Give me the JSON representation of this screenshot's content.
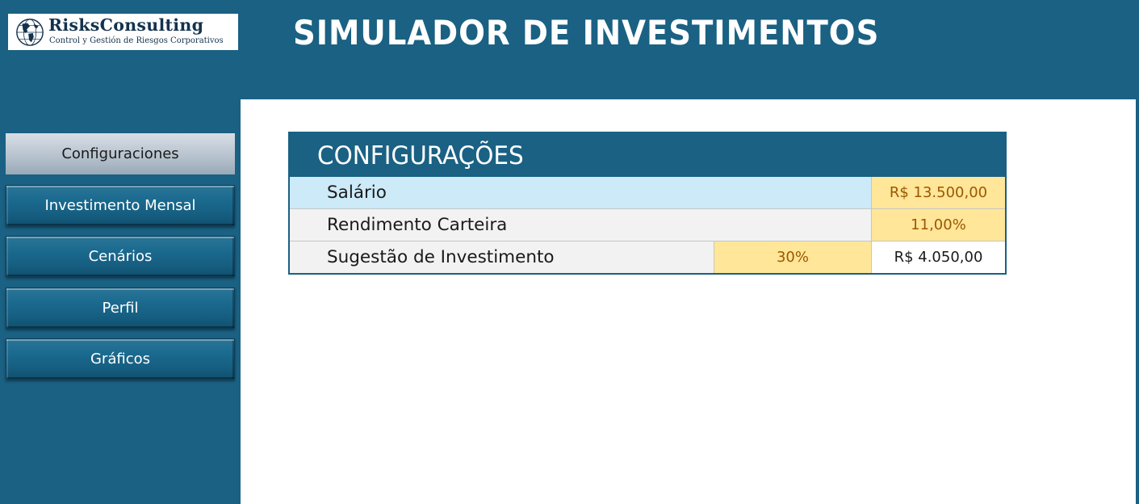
{
  "header": {
    "logo": {
      "name": "RisksConsulting",
      "tagline": "Control y Gestión de Riesgos Corporativos"
    },
    "title": "SIMULADOR DE INVESTIMENTOS",
    "background_color": "#1a6183"
  },
  "sidebar": {
    "items": [
      {
        "label": "Configuraciones",
        "active": true
      },
      {
        "label": "Investimento Mensal",
        "active": false
      },
      {
        "label": "Cenários",
        "active": false
      },
      {
        "label": "Perfil",
        "active": false
      },
      {
        "label": "Gráficos",
        "active": false
      }
    ]
  },
  "config": {
    "title": "CONFIGURAÇÕES",
    "rows": [
      {
        "label": "Salário",
        "value": "R$ 13.500,00"
      },
      {
        "label": "Rendimento Carteira",
        "value": "11,00%"
      },
      {
        "label": "Sugestão de Investimento",
        "percent": "30%",
        "value": "R$ 4.050,00"
      }
    ]
  },
  "colors": {
    "brand": "#1a6183",
    "input_yellow": "#ffe699",
    "input_text": "#9c5700",
    "highlight_row": "#cdeaf8",
    "row_gray": "#f2f2f2"
  }
}
